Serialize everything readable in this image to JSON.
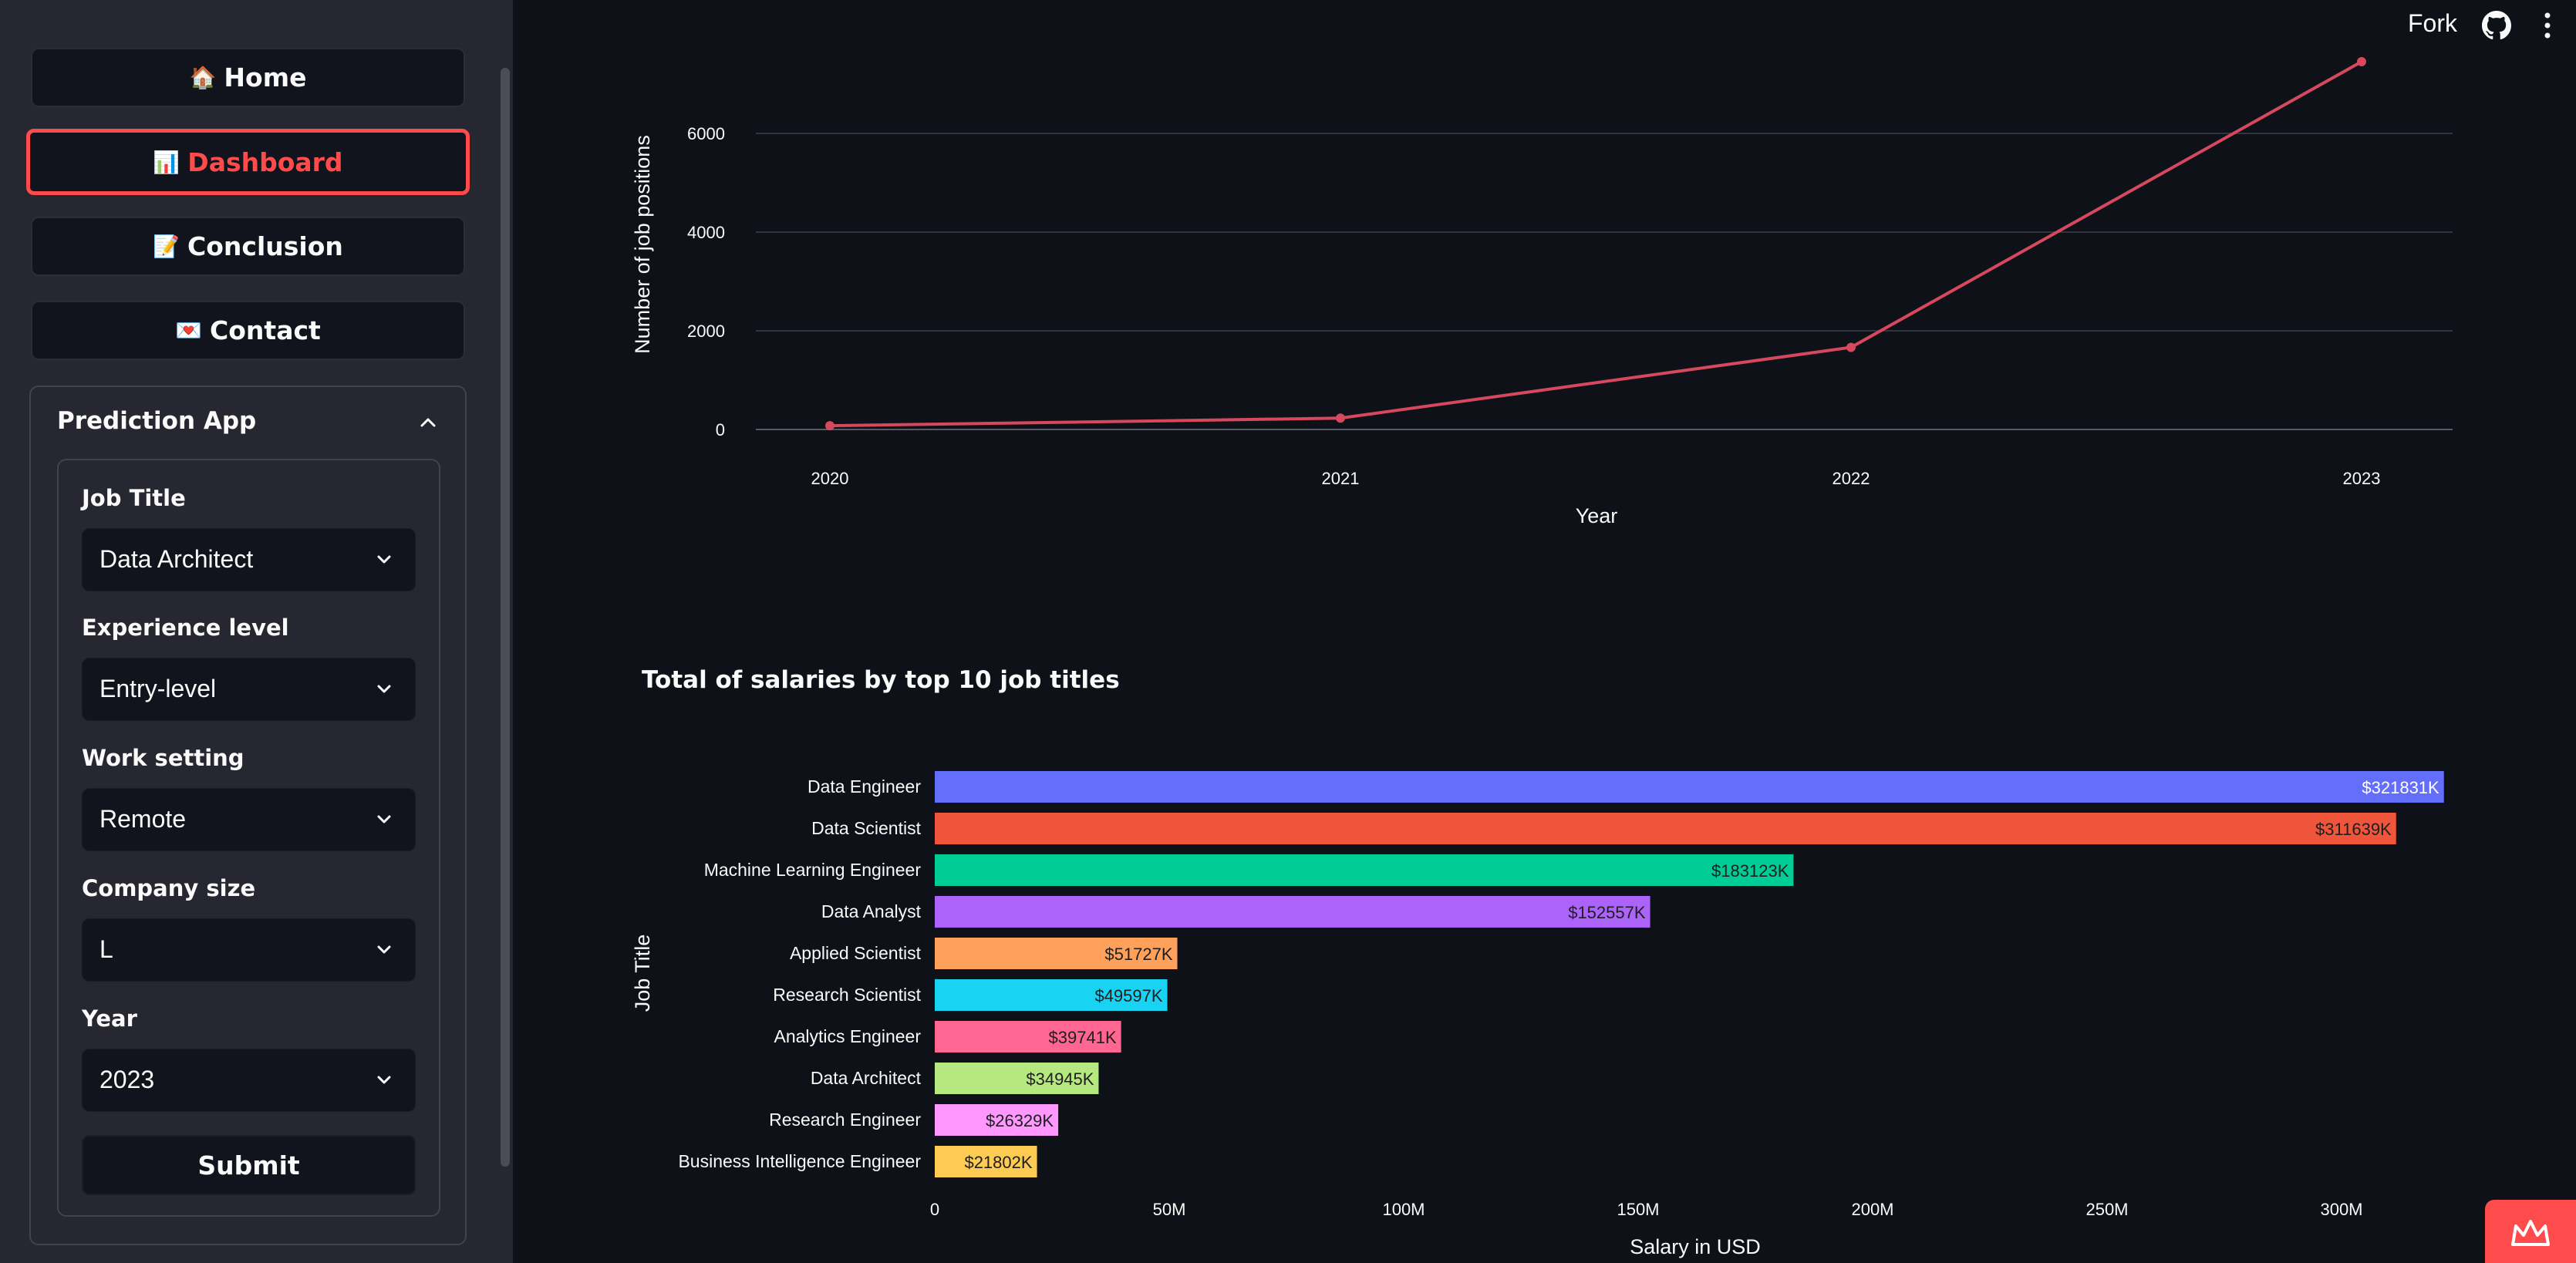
{
  "sidebar": {
    "nav": [
      {
        "icon": "🏠",
        "label": "Home"
      },
      {
        "icon": "📊",
        "label": "Dashboard"
      },
      {
        "icon": "📝",
        "label": "Conclusion"
      },
      {
        "icon": "💌",
        "label": "Contact"
      }
    ],
    "active": "Dashboard",
    "expander_title": "Prediction App",
    "form": {
      "fields": [
        {
          "label": "Job Title",
          "value": "Data Architect"
        },
        {
          "label": "Experience level",
          "value": "Entry-level"
        },
        {
          "label": "Work setting",
          "value": "Remote"
        },
        {
          "label": "Company size",
          "value": "L"
        },
        {
          "label": "Year",
          "value": "2023"
        }
      ],
      "submit_label": "Submit"
    }
  },
  "header": {
    "fork_label": "Fork"
  },
  "chart_data": [
    {
      "type": "line",
      "x": [
        "2020",
        "2021",
        "2022",
        "2023"
      ],
      "series": [
        {
          "values": [
            76,
            230,
            1664,
            7453
          ]
        }
      ],
      "xlabel": "Year",
      "ylabel": "Number of job positions",
      "yticks": [
        0,
        2000,
        4000,
        6000
      ],
      "ylim": [
        0,
        7800
      ],
      "grid": true,
      "color": "#d6485e"
    },
    {
      "type": "bar",
      "orientation": "horizontal",
      "title": "Total of salaries by top 10 job titles",
      "xlabel": "Salary in USD",
      "ylabel": "Job Title",
      "xlim": [
        0,
        330000000
      ],
      "xticks": [
        {
          "value": 0,
          "label": "0"
        },
        {
          "value": 50000000,
          "label": "50M"
        },
        {
          "value": 100000000,
          "label": "100M"
        },
        {
          "value": 150000000,
          "label": "150M"
        },
        {
          "value": 200000000,
          "label": "200M"
        },
        {
          "value": 250000000,
          "label": "250M"
        },
        {
          "value": 300000000,
          "label": "300M"
        }
      ],
      "categories": [
        "Data Engineer",
        "Data Scientist",
        "Machine Learning Engineer",
        "Data Analyst",
        "Applied Scientist",
        "Research Scientist",
        "Analytics Engineer",
        "Data Architect",
        "Research Engineer",
        "Business Intelligence Engineer"
      ],
      "values": [
        321831000,
        311639000,
        183123000,
        152557000,
        51727000,
        49597000,
        39741000,
        34945000,
        26329000,
        21802000
      ],
      "labels": [
        "$321831K",
        "$311639K",
        "$183123K",
        "$152557K",
        "$51727K",
        "$49597K",
        "$39741K",
        "$34945K",
        "$26329K",
        "$21802K"
      ],
      "colors": [
        "#636efa",
        "#ef553b",
        "#00cc96",
        "#ab63fa",
        "#ffa15a",
        "#19d3f3",
        "#ff6692",
        "#b6e880",
        "#ff97ff",
        "#fecb52"
      ]
    }
  ]
}
